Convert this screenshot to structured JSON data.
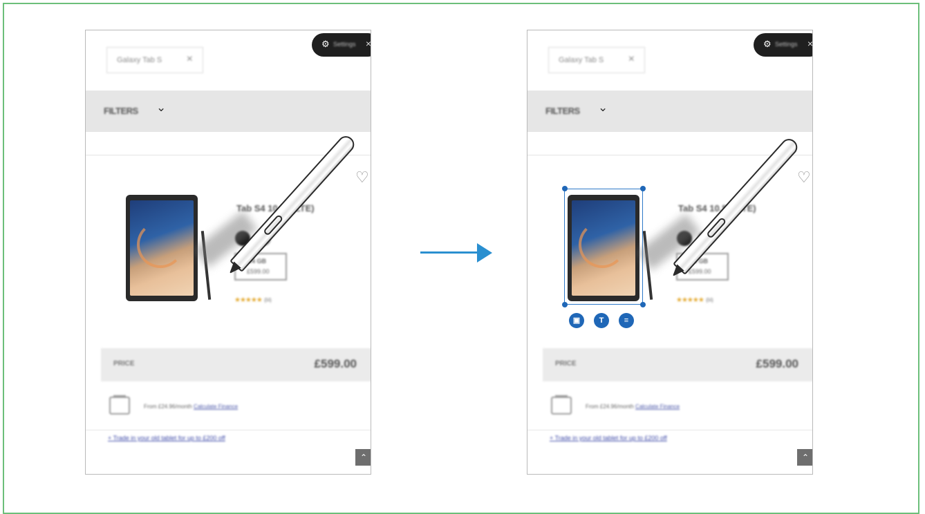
{
  "colors": {
    "frame_border": "#6cbf7a",
    "arrow": "#2a8fd0",
    "selection": "#1f67b7",
    "star": "#e3a72a"
  },
  "left": {
    "search_chip": {
      "text": "Galaxy Tab S",
      "close_icon": "×"
    },
    "settings_pill": {
      "gear_icon": "⚙",
      "label": "Settings",
      "close_icon": "×"
    },
    "filters": {
      "label": "FILTERS",
      "chevron": "⌄"
    },
    "product": {
      "favorite_icon": "♡",
      "title": "Tab S4 10.5\" (LTE)",
      "storage": {
        "line1": "64 GB",
        "line2": "£599.00"
      },
      "stars": "★★★★★",
      "review_count": "(84)",
      "edit_fab_icon": "✎"
    },
    "price": {
      "label": "PRICE",
      "value": "£599.00"
    },
    "finance": {
      "text": "From £24.96/month",
      "link": "Calculate Finance"
    },
    "trade_in": "+ Trade in your old tablet for up to £200 off",
    "scroll_top_icon": "⌃"
  },
  "right": {
    "search_chip": {
      "text": "Galaxy Tab S",
      "close_icon": "×"
    },
    "settings_pill": {
      "gear_icon": "⚙",
      "label": "Settings",
      "close_icon": "×"
    },
    "filters": {
      "label": "FILTERS",
      "chevron": "⌄"
    },
    "product": {
      "favorite_icon": "♡",
      "title": "Tab S4 10.5\" (LTE)",
      "storage": {
        "line1": "64 GB",
        "line2": "£599.00"
      },
      "stars": "★★★★★",
      "review_count": "(84)",
      "edit_fab_icon": "✎"
    },
    "selection_tools": [
      {
        "name": "image-icon",
        "glyph": "▣"
      },
      {
        "name": "text-extract-icon",
        "glyph": "T"
      },
      {
        "name": "list-icon",
        "glyph": "≡"
      }
    ],
    "price": {
      "label": "PRICE",
      "value": "£599.00"
    },
    "finance": {
      "text": "From £24.96/month",
      "link": "Calculate Finance"
    },
    "trade_in": "+ Trade in your old tablet for up to £200 off",
    "scroll_top_icon": "⌃"
  }
}
